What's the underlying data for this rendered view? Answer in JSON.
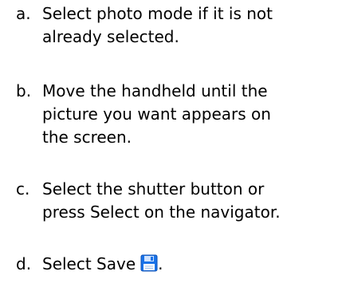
{
  "steps": [
    {
      "marker": "a.",
      "lines": [
        "Select photo mode if it is not",
        "already selected."
      ]
    },
    {
      "marker": "b.",
      "lines": [
        "Move the handheld until the",
        "picture you want appears on",
        "the screen."
      ]
    },
    {
      "marker": "c.",
      "lines": [
        "Select the shutter button or",
        "press Select on the navigator."
      ]
    },
    {
      "marker": "d.",
      "lines": [
        "Select Save"
      ],
      "icon": "save-icon",
      "trailing": "."
    }
  ],
  "colors": {
    "text": "#000000",
    "icon_blue": "#1a73e8",
    "icon_light": "#cfe3ff"
  }
}
